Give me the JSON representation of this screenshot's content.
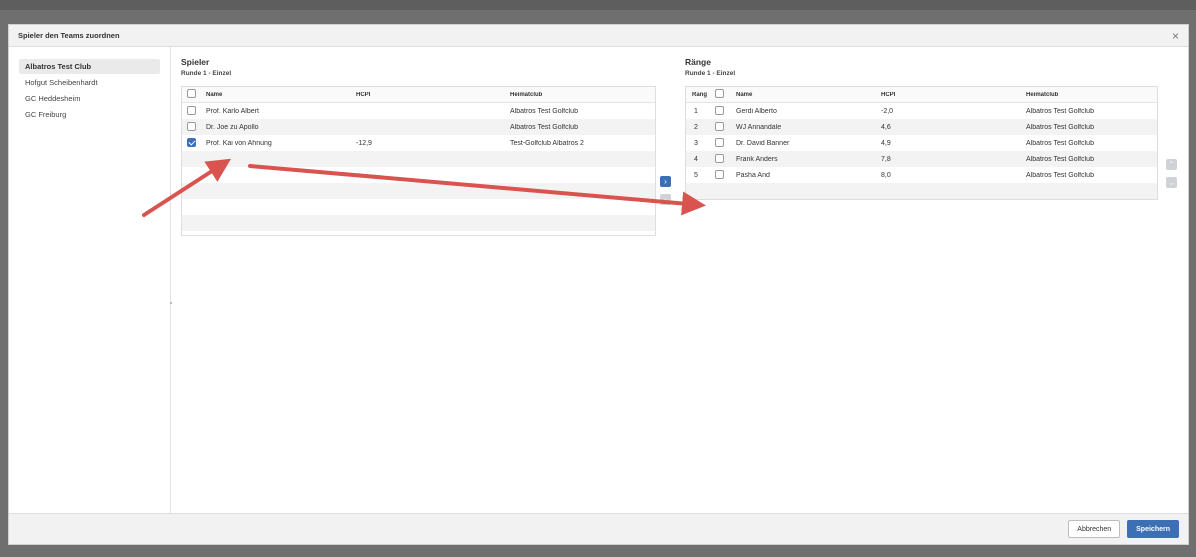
{
  "dialog": {
    "title": "Spieler den Teams zuordnen",
    "close_glyph": "×"
  },
  "sidebar": {
    "items": [
      {
        "label": "Albatros Test Club",
        "active": true
      },
      {
        "label": "Hofgut Scheibenhardt",
        "active": false
      },
      {
        "label": "GC Heddesheim",
        "active": false
      },
      {
        "label": "GC Freiburg",
        "active": false
      }
    ]
  },
  "players": {
    "title": "Spieler",
    "subtitle": "Runde 1 - Einzel",
    "columns": {
      "name": "Name",
      "hcpi": "HCPI",
      "club": "Heimatclub"
    },
    "rows": [
      {
        "name": "Prof. Karlo Albert",
        "hcpi": "",
        "club": "Albatros Test Golfclub",
        "checked": false
      },
      {
        "name": "Dr. Joe zu Apollo",
        "hcpi": "",
        "club": "Albatros Test Golfclub",
        "checked": false
      },
      {
        "name": "Prof. Kai von Ahnung",
        "hcpi": "-12,9",
        "club": "Test-Golfclub Albatros 2",
        "checked": true
      }
    ]
  },
  "transfer": {
    "move_right_glyph": "›",
    "move_left_glyph": "‹"
  },
  "ranks": {
    "title": "Ränge",
    "subtitle": "Runde 1 - Einzel",
    "columns": {
      "rank": "Rang",
      "name": "Name",
      "hcpi": "HCPI",
      "club": "Heimatclub"
    },
    "rows": [
      {
        "rank": "1",
        "name": "Gerdi Alberto",
        "hcpi": "-2,0",
        "club": "Albatros Test Golfclub"
      },
      {
        "rank": "2",
        "name": "WJ Annandale",
        "hcpi": "4,6",
        "club": "Albatros Test Golfclub"
      },
      {
        "rank": "3",
        "name": "Dr. David Banner",
        "hcpi": "4,9",
        "club": "Albatros Test Golfclub"
      },
      {
        "rank": "4",
        "name": "Frank Anders",
        "hcpi": "7,8",
        "club": "Albatros Test Golfclub"
      },
      {
        "rank": "5",
        "name": "Pasha And",
        "hcpi": "8,0",
        "club": "Albatros Test Golfclub"
      }
    ],
    "up_glyph": "⌃",
    "down_glyph": "⌄"
  },
  "footer": {
    "cancel_label": "Abbrechen",
    "save_label": "Speichern"
  },
  "colors": {
    "accent": "#3d6fb5",
    "annotation_arrow": "#d9534f"
  }
}
